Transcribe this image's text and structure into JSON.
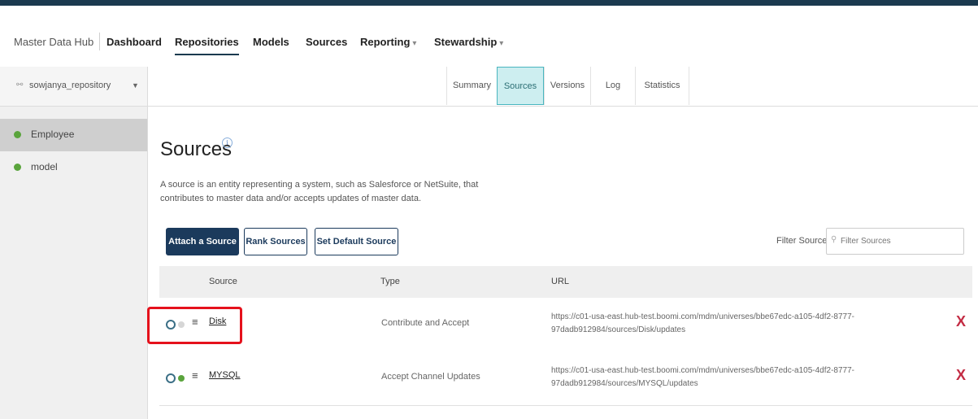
{
  "header": {
    "app_title": "Master Data Hub",
    "nav": [
      {
        "label": "Dashboard",
        "caret": ""
      },
      {
        "label": "Repositories",
        "caret": ""
      },
      {
        "label": "Models",
        "caret": ""
      },
      {
        "label": "Sources",
        "caret": ""
      },
      {
        "label": "Reporting",
        "caret": "▾"
      },
      {
        "label": "Stewardship",
        "caret": "▾"
      }
    ],
    "active_nav": "Repositories"
  },
  "sidebar": {
    "repository": "sowjanya_repository",
    "models": [
      {
        "label": "Employee",
        "selected": true
      },
      {
        "label": "model",
        "selected": false
      }
    ]
  },
  "tabs": [
    "Summary",
    "Sources",
    "Versions",
    "Log",
    "Statistics"
  ],
  "active_tab": "Sources",
  "main": {
    "title": "Sources",
    "info_glyph": "i",
    "description": "A source is an entity representing a system, such as Salesforce or NetSuite, that contributes to master data and/or accepts updates of master data.",
    "buttons": {
      "attach": "Attach a Source",
      "rank": "Rank Sources",
      "set_default": "Set Default Source"
    },
    "filter": {
      "label": "Filter Sources",
      "placeholder": "Filter Sources",
      "value": ""
    }
  },
  "table": {
    "columns": [
      "Source",
      "Type",
      "URL"
    ],
    "rows": [
      {
        "name": "Disk",
        "status_color": "#d6d6d6",
        "type": "Contribute and Accept",
        "url": "https://c01-usa-east.hub-test.boomi.com/mdm/universes/bbe67edc-a105-4df2-8777-97dadb912984/sources/Disk/updates",
        "delete": "X"
      },
      {
        "name": "MYSQL",
        "status_color": "#5aa43c",
        "type": "Accept Channel Updates",
        "url": "https://c01-usa-east.hub-test.boomi.com/mdm/universes/bbe67edc-a105-4df2-8777-97dadb912984/sources/MYSQL/updates",
        "delete": "X"
      }
    ]
  },
  "colors": {
    "brand_dark": "#1b3a4f",
    "button_primary": "#1b3a5c",
    "tab_active_bg": "#cdeef0",
    "tab_active_border": "#49b6bf",
    "delete_red": "#c32c44",
    "highlight_red": "#e5111c",
    "status_green": "#5aa43c"
  }
}
